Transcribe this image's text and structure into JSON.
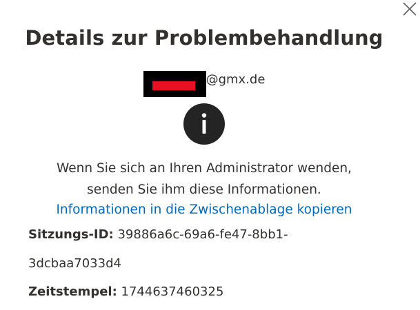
{
  "dialog": {
    "title": "Details zur Problembehandlung",
    "close_icon": "close-icon",
    "account": {
      "email_domain": "@gmx.de"
    },
    "info_icon": "info-icon",
    "message_line1": "Wenn Sie sich an Ihren Administrator wenden,",
    "message_line2": "senden Sie ihm diese Informationen.",
    "copy_link": "Informationen in die Zwischenablage kopieren",
    "session_id_label": "Sitzungs-ID:",
    "session_id_value_part1": "39886a6c-69a6-fe47-8bb1-",
    "session_id_value_part2": "3dcbaa7033d4",
    "timestamp_label": "Zeitstempel:",
    "timestamp_value": "1744637460325",
    "colors": {
      "link": "#0067b8",
      "text": "#323130",
      "redaction_outer": "#000000",
      "redaction_inner": "#e81123",
      "icon_bg": "#242424"
    }
  }
}
